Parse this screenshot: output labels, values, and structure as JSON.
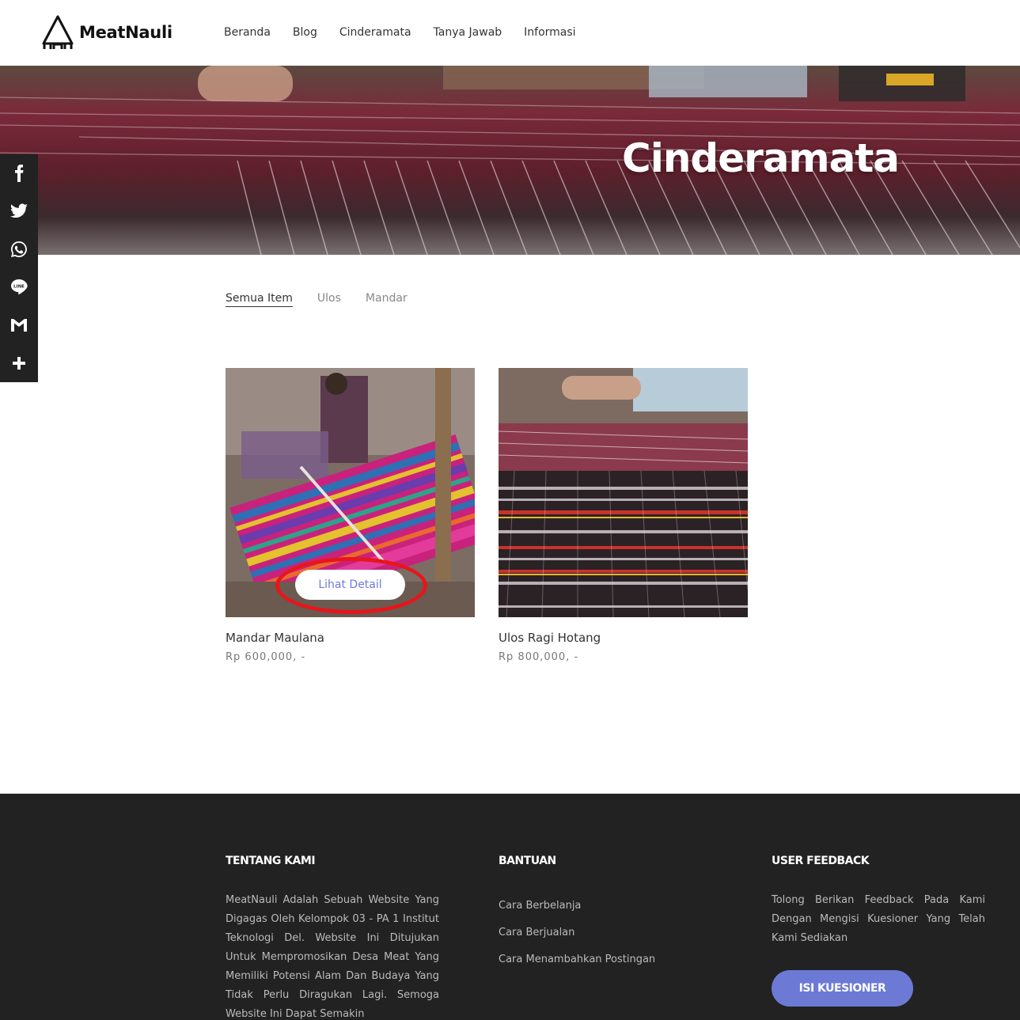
{
  "brand": {
    "name": "MeatNauli"
  },
  "nav": [
    "Beranda",
    "Blog",
    "Cinderamata",
    "Tanya Jawab",
    "Informasi"
  ],
  "hero": {
    "title": "Cinderamata"
  },
  "share": [
    "facebook-icon",
    "twitter-icon",
    "whatsapp-icon",
    "line-icon",
    "gmail-icon",
    "plus-icon"
  ],
  "filters": [
    "Semua Item",
    "Ulos",
    "Mandar"
  ],
  "products": [
    {
      "name": "Mandar Maulana",
      "price": "Rp 600,000, -",
      "detail_label": "Lihat Detail"
    },
    {
      "name": "Ulos Ragi Hotang",
      "price": "Rp 800,000, -"
    }
  ],
  "footer": {
    "about": {
      "title": "TENTANG KAMI",
      "text": "MeatNauli Adalah Sebuah Website Yang Digagas Oleh Kelompok 03 - PA 1 Institut Teknologi Del. Website Ini Ditujukan Untuk Mempromosikan Desa Meat Yang Memiliki Potensi Alam Dan Budaya Yang Tidak Perlu Diragukan Lagi. Semoga Website Ini Dapat Semakin"
    },
    "help": {
      "title": "BANTUAN",
      "links": [
        "Cara Berbelanja",
        "Cara Berjualan",
        "Cara Menambahkan Postingan"
      ]
    },
    "feedback": {
      "title": "USER FEEDBACK",
      "text": "Tolong Berikan Feedback Pada Kami Dengan Mengisi Kuesioner Yang Telah Kami Sediakan",
      "button": "ISI KUESIONER"
    }
  },
  "colors": {
    "accent": "#6c7ad6",
    "footer_bg": "#222222",
    "highlight": "#e8151b"
  }
}
